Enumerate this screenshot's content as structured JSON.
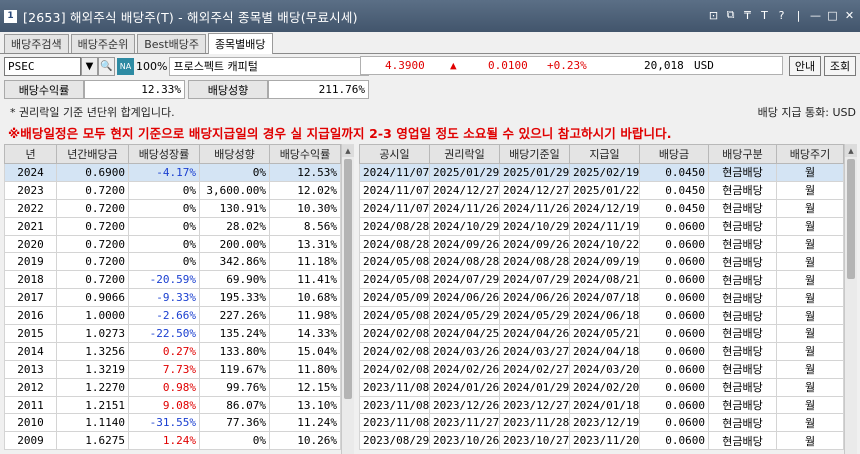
{
  "window": {
    "number": "1",
    "title": "[2653] 해외주식 배당주(T) - 해외주식 종목별 배당(무료시세)",
    "buttons": [
      "⊡",
      "⧉",
      "₸",
      "T",
      "?",
      "|",
      "—",
      "□",
      "✕"
    ]
  },
  "tabs": [
    "배당주검색",
    "배당주순위",
    "Best배당주",
    "종목별배당"
  ],
  "search": {
    "code": "PSEC",
    "search_icon": "🔍",
    "na_badge": "NA",
    "percent": "100%",
    "stock_name": "프로스펙트 캐피털",
    "price": "4.3900",
    "arrow": "▲",
    "change": "0.0100",
    "change_pct": "+0.23%",
    "volume": "20,018",
    "currency": "USD",
    "guide_btn": "안내",
    "query_btn": "조회"
  },
  "yield": {
    "yield_label": "배당수익률",
    "yield_value": "12.33%",
    "payout_label": "배당성향",
    "payout_value": "211.76%"
  },
  "notes": {
    "annual_note": "* 권리락일 기준 년단위 합계입니다.",
    "currency_note": "배당 지급 통화: USD",
    "warning": "※배당일정은 모두 현지 기준으로 배당지급일의 경우 실 지급일까지 2-3 영업일 정도 소요될 수 있으니 참고하시기 바랍니다."
  },
  "left_table": {
    "headers": [
      "년",
      "년간배당금",
      "배당성장률",
      "배당성향",
      "배당수익률"
    ],
    "rows": [
      [
        "2024",
        "0.6900",
        "-4.17%",
        "0%",
        "12.53%"
      ],
      [
        "2023",
        "0.7200",
        "0%",
        "3,600.00%",
        "12.02%"
      ],
      [
        "2022",
        "0.7200",
        "0%",
        "130.91%",
        "10.30%"
      ],
      [
        "2021",
        "0.7200",
        "0%",
        "28.02%",
        "8.56%"
      ],
      [
        "2020",
        "0.7200",
        "0%",
        "200.00%",
        "13.31%"
      ],
      [
        "2019",
        "0.7200",
        "0%",
        "342.86%",
        "11.18%"
      ],
      [
        "2018",
        "0.7200",
        "-20.59%",
        "69.90%",
        "11.41%"
      ],
      [
        "2017",
        "0.9066",
        "-9.33%",
        "195.33%",
        "10.68%"
      ],
      [
        "2016",
        "1.0000",
        "-2.66%",
        "227.26%",
        "11.98%"
      ],
      [
        "2015",
        "1.0273",
        "-22.50%",
        "135.24%",
        "14.33%"
      ],
      [
        "2014",
        "1.3256",
        "0.27%",
        "133.80%",
        "15.04%"
      ],
      [
        "2013",
        "1.3219",
        "7.73%",
        "119.67%",
        "11.80%"
      ],
      [
        "2012",
        "1.2270",
        "0.98%",
        "99.76%",
        "12.15%"
      ],
      [
        "2011",
        "1.2151",
        "9.08%",
        "86.07%",
        "13.10%"
      ],
      [
        "2010",
        "1.1140",
        "-31.55%",
        "77.36%",
        "11.24%"
      ],
      [
        "2009",
        "1.6275",
        "1.24%",
        "0%",
        "10.26%"
      ]
    ]
  },
  "right_table": {
    "headers": [
      "공시일",
      "권리락일",
      "배당기준일",
      "지급일",
      "배당금",
      "배당구분",
      "배당주기"
    ],
    "rows": [
      [
        "2024/11/07",
        "2025/01/29",
        "2025/01/29",
        "2025/02/19",
        "0.0450",
        "현금배당",
        "월"
      ],
      [
        "2024/11/07",
        "2024/12/27",
        "2024/12/27",
        "2025/01/22",
        "0.0450",
        "현금배당",
        "월"
      ],
      [
        "2024/11/07",
        "2024/11/26",
        "2024/11/26",
        "2024/12/19",
        "0.0450",
        "현금배당",
        "월"
      ],
      [
        "2024/08/28",
        "2024/10/29",
        "2024/10/29",
        "2024/11/19",
        "0.0600",
        "현금배당",
        "월"
      ],
      [
        "2024/08/28",
        "2024/09/26",
        "2024/09/26",
        "2024/10/22",
        "0.0600",
        "현금배당",
        "월"
      ],
      [
        "2024/05/08",
        "2024/08/28",
        "2024/08/28",
        "2024/09/19",
        "0.0600",
        "현금배당",
        "월"
      ],
      [
        "2024/05/08",
        "2024/07/29",
        "2024/07/29",
        "2024/08/21",
        "0.0600",
        "현금배당",
        "월"
      ],
      [
        "2024/05/09",
        "2024/06/26",
        "2024/06/26",
        "2024/07/18",
        "0.0600",
        "현금배당",
        "월"
      ],
      [
        "2024/05/08",
        "2024/05/29",
        "2024/05/29",
        "2024/06/18",
        "0.0600",
        "현금배당",
        "월"
      ],
      [
        "2024/02/08",
        "2024/04/25",
        "2024/04/26",
        "2024/05/21",
        "0.0600",
        "현금배당",
        "월"
      ],
      [
        "2024/02/08",
        "2024/03/26",
        "2024/03/27",
        "2024/04/18",
        "0.0600",
        "현금배당",
        "월"
      ],
      [
        "2024/02/08",
        "2024/02/26",
        "2024/02/27",
        "2024/03/20",
        "0.0600",
        "현금배당",
        "월"
      ],
      [
        "2023/11/08",
        "2024/01/26",
        "2024/01/29",
        "2024/02/20",
        "0.0600",
        "현금배당",
        "월"
      ],
      [
        "2023/11/08",
        "2023/12/26",
        "2023/12/27",
        "2024/01/18",
        "0.0600",
        "현금배당",
        "월"
      ],
      [
        "2023/11/08",
        "2023/11/27",
        "2023/11/28",
        "2023/12/19",
        "0.0600",
        "현금배당",
        "월"
      ],
      [
        "2023/08/29",
        "2023/10/26",
        "2023/10/27",
        "2023/11/20",
        "0.0600",
        "현금배당",
        "월"
      ]
    ]
  },
  "colors": {
    "up": "#e00000",
    "down": "#1a3fd0",
    "selected_row": "#d4e4f4"
  }
}
